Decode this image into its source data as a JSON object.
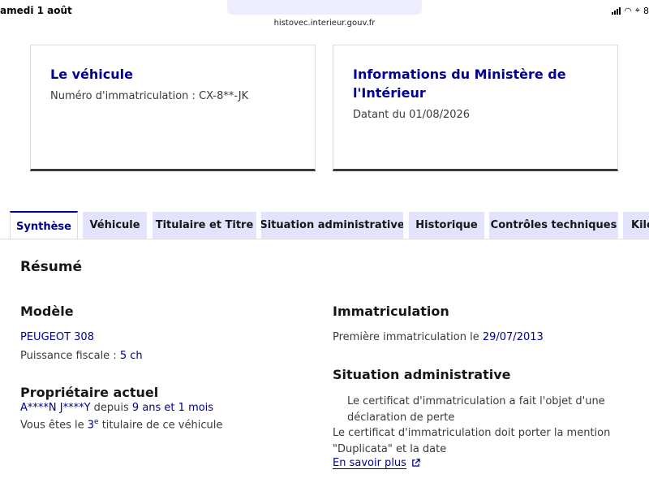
{
  "statusbar": {
    "time": "amedi 1 août",
    "battery": "8"
  },
  "browser": {
    "url": "histovec.interieur.gouv.fr"
  },
  "cards": {
    "vehicle": {
      "title": "Le véhicule",
      "text": "Numéro d'immatriculation : CX-8**-JK"
    },
    "ministry": {
      "title_line1": "Informations du Ministère de",
      "title_line2": "l'Intérieur",
      "text": "Datant du 01/08/2026"
    }
  },
  "tabs": [
    {
      "label": "Synthèse"
    },
    {
      "label": "Véhicule"
    },
    {
      "label": "Titulaire et Titre"
    },
    {
      "label": "Situation administrative"
    },
    {
      "label": "Historique"
    },
    {
      "label": "Contrôles techniques"
    },
    {
      "label": "Kilo"
    }
  ],
  "summary": {
    "title": "Résumé",
    "model": {
      "heading": "Modèle",
      "name": "PEUGEOT 308",
      "power_label": "Puissance fiscale : ",
      "power_value": "5 ch"
    },
    "owner": {
      "heading": "Propriétaire actuel",
      "name": "A****N J****Y",
      "since_label": " depuis ",
      "since_value": "9 ans et 1 mois",
      "rank_prefix": "Vous êtes le ",
      "rank_value": "3",
      "rank_sup": "e",
      "rank_suffix": " titulaire de ce véhicule"
    },
    "registration": {
      "heading": "Immatriculation",
      "label": "Première immatriculation le ",
      "date": "29/07/2013"
    },
    "admin": {
      "heading": "Situation administrative",
      "line1": "Le certificat d'immatriculation a fait l'objet d'une déclaration de perte",
      "line2": "Le certificat d'immatriculation doit porter la mention \"Duplicata\" et la date",
      "link": "En savoir plus"
    }
  }
}
